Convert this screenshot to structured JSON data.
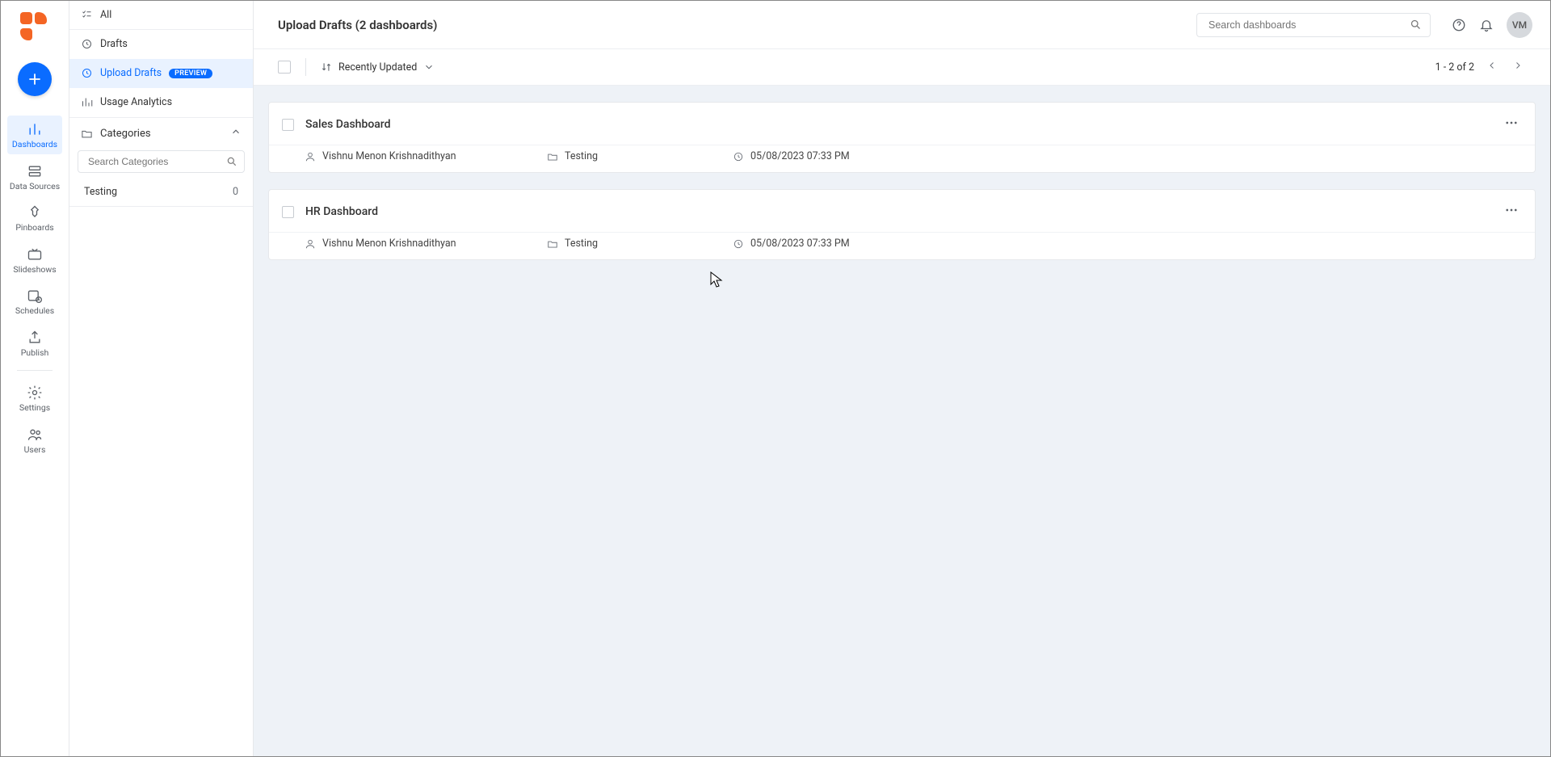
{
  "nav_rail": {
    "items": [
      {
        "label": "Dashboards"
      },
      {
        "label": "Data Sources"
      },
      {
        "label": "Pinboards"
      },
      {
        "label": "Slideshows"
      },
      {
        "label": "Schedules"
      },
      {
        "label": "Publish"
      },
      {
        "label": "Settings"
      },
      {
        "label": "Users"
      }
    ]
  },
  "sub_sidebar": {
    "all_label": "All",
    "drafts_label": "Drafts",
    "upload_drafts_label": "Upload Drafts",
    "preview_badge": "PREVIEW",
    "usage_label": "Usage Analytics",
    "categories_label": "Categories",
    "search_placeholder": "Search Categories",
    "category_rows": [
      {
        "name": "Testing",
        "count": "0"
      }
    ]
  },
  "topbar": {
    "page_title": "Upload Drafts (2 dashboards)",
    "search_placeholder": "Search dashboards",
    "avatar_initials": "VM"
  },
  "toolbar": {
    "sort_label": "Recently Updated",
    "pagination_text": "1 - 2 of 2"
  },
  "dashboards": [
    {
      "title": "Sales Dashboard",
      "owner": "Vishnu Menon Krishnadithyan",
      "category": "Testing",
      "timestamp": "05/08/2023 07:33 PM"
    },
    {
      "title": "HR Dashboard",
      "owner": "Vishnu Menon Krishnadithyan",
      "category": "Testing",
      "timestamp": "05/08/2023 07:33 PM"
    }
  ]
}
